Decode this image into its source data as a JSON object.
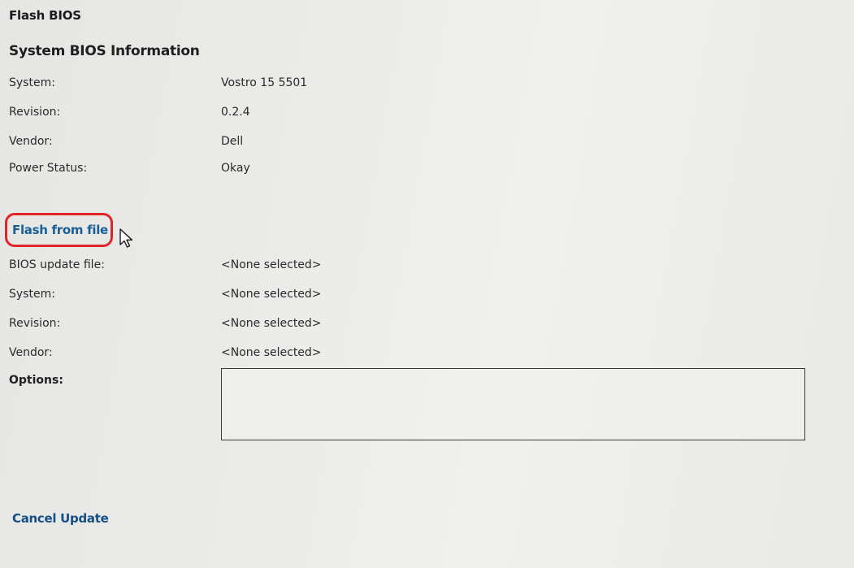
{
  "page": {
    "title": "Flash BIOS"
  },
  "system_bios_info": {
    "heading": "System BIOS Information",
    "rows": [
      {
        "label": "System:",
        "value": "Vostro 15 5501"
      },
      {
        "label": "Revision:",
        "value": "0.2.4"
      },
      {
        "label": "Vendor:",
        "value": "Dell"
      },
      {
        "label": "Power Status:",
        "value": "Okay"
      }
    ]
  },
  "flash_from_file": {
    "link_label": "Flash from file",
    "highlight_color": "#e0242a",
    "link_color": "#1c5e96",
    "rows": [
      {
        "label": "BIOS update file:",
        "value": "<None selected>"
      },
      {
        "label": "System:",
        "value": "<None selected>"
      },
      {
        "label": "Revision:",
        "value": "<None selected>"
      },
      {
        "label": "Vendor:",
        "value": "<None selected>"
      }
    ],
    "options_label": "Options:",
    "options_value": ""
  },
  "footer": {
    "cancel_label": "Cancel Update"
  },
  "icons": {
    "cursor": "mouse-pointer-icon"
  }
}
